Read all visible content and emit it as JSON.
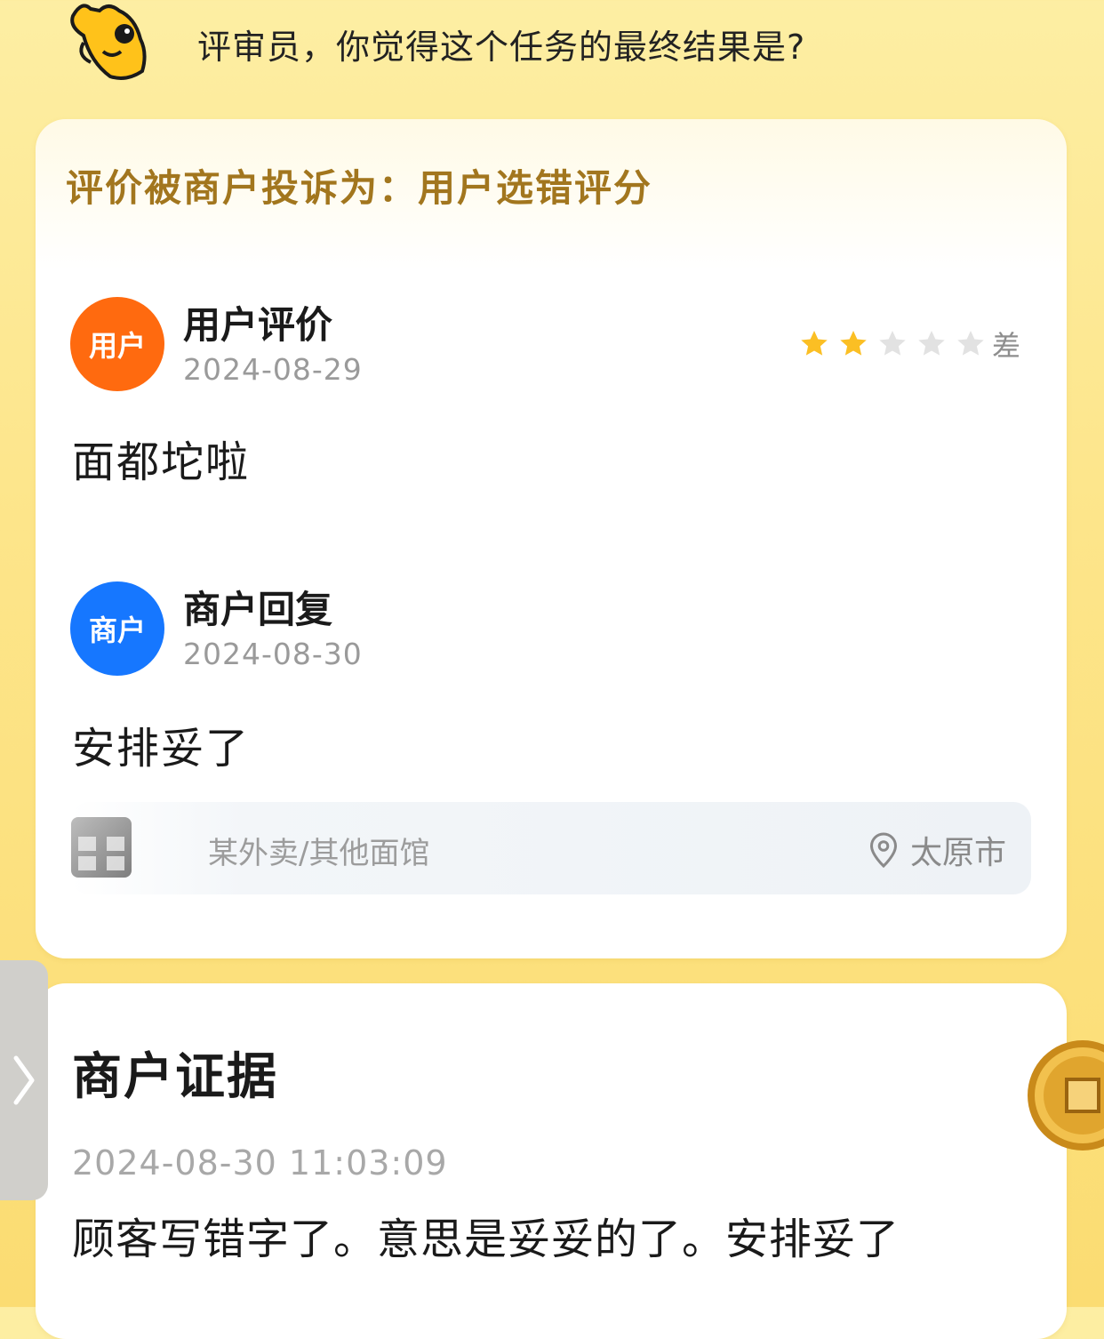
{
  "header": {
    "question": "评审员，你觉得这个任务的最终结果是?",
    "mascot_icon": "mascot-icon"
  },
  "complaint": {
    "text": "评价被商户投诉为：用户选错评分"
  },
  "user_review": {
    "avatar_label": "用户",
    "title": "用户评价",
    "date": "2024-08-29",
    "rating": 2,
    "rating_max": 5,
    "rating_label": "差",
    "content": "面都坨啦",
    "avatar_color": "#ff6a0f"
  },
  "merchant_reply": {
    "avatar_label": "商户",
    "title": "商户回复",
    "date": "2024-08-30",
    "content": "安排妥了",
    "avatar_color": "#1677ff"
  },
  "store": {
    "category": "某外卖/其他面馆",
    "city": "太原市",
    "location_icon": "location-pin-icon"
  },
  "evidence": {
    "title": "商户证据",
    "timestamp": "2024-08-30 11:03:09",
    "content": "顾客写错字了。意思是妥妥的了。安排妥了"
  },
  "colors": {
    "star_filled": "#fbbf24",
    "star_empty": "#e2e2e2",
    "complaint_text": "#a2761e"
  }
}
